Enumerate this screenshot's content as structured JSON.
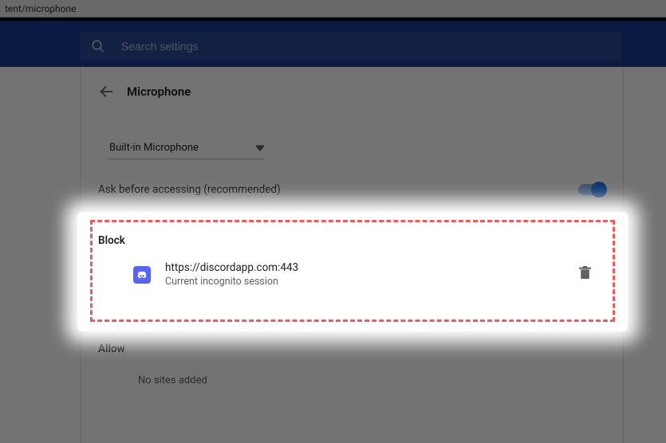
{
  "url_fragment": "tent/microphone",
  "search": {
    "placeholder": "Search settings"
  },
  "page": {
    "title": "Microphone",
    "device_selected": "Built-in Microphone",
    "ask_label": "Ask before accessing (recommended)",
    "toggle_on": true
  },
  "block": {
    "heading": "Block",
    "items": [
      {
        "url": "https://discordapp.com:443",
        "sub": "Current incognito session"
      }
    ]
  },
  "allow": {
    "heading": "Allow",
    "empty_text": "No sites added"
  }
}
